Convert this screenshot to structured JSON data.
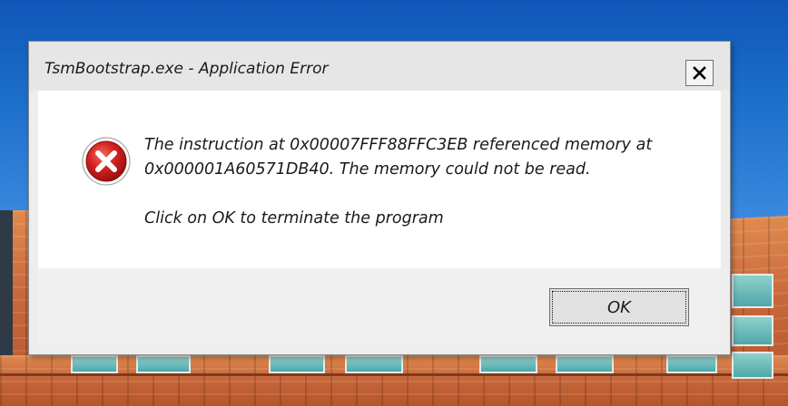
{
  "window": {
    "title": "TsmBootstrap.exe - Application Error",
    "close_icon": "close-icon"
  },
  "message": {
    "line1": "The instruction at 0x00007FFF88FFC3EB referenced memory at",
    "line2": "0x000001A60571DB40. The memory could not be read.",
    "prompt": "Click on OK to terminate the program",
    "icon": "error-icon"
  },
  "buttons": {
    "ok_label": "OK"
  },
  "colors": {
    "error_red": "#d21f1f",
    "dialog_bg": "#ededed",
    "content_bg": "#ffffff"
  }
}
